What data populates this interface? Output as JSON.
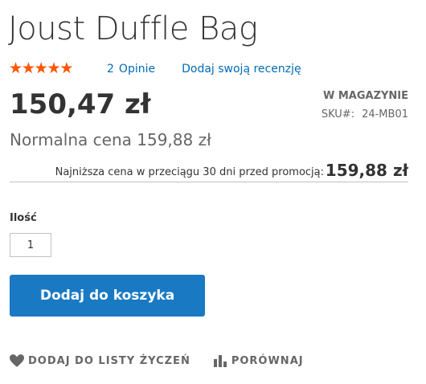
{
  "product": {
    "title": "Joust Duffle Bag",
    "rating_percent": 100,
    "rating_stars": "★★★★★",
    "reviews_count": "2",
    "reviews_label": "Opinie",
    "add_review_label": "Dodaj swoją recenzję",
    "final_price": "150,47 zł",
    "stock_status": "W MAGAZYNIE",
    "sku_label": "SKU#:",
    "sku_value": "24-MB01",
    "regular_price": "Normalna cena 159,88 zł",
    "lowest_price_label": "Najniższa cena w przeciągu 30 dni przed promocją:",
    "lowest_price_value": "159,88 zł"
  },
  "cart": {
    "qty_label": "Ilość",
    "qty_value": "1",
    "add_to_cart_label": "Dodaj do koszyka"
  },
  "actions": {
    "wishlist_label": "DODAJ DO LISTY ŻYCZEŃ",
    "wishlist_icon": "heart-icon",
    "compare_label": "PORÓWNAJ",
    "compare_icon": "bar-chart-icon"
  },
  "colors": {
    "accent": "#1979c3",
    "link": "#006bb4",
    "star": "#ff5501",
    "text": "#333333",
    "muted": "#666666"
  }
}
